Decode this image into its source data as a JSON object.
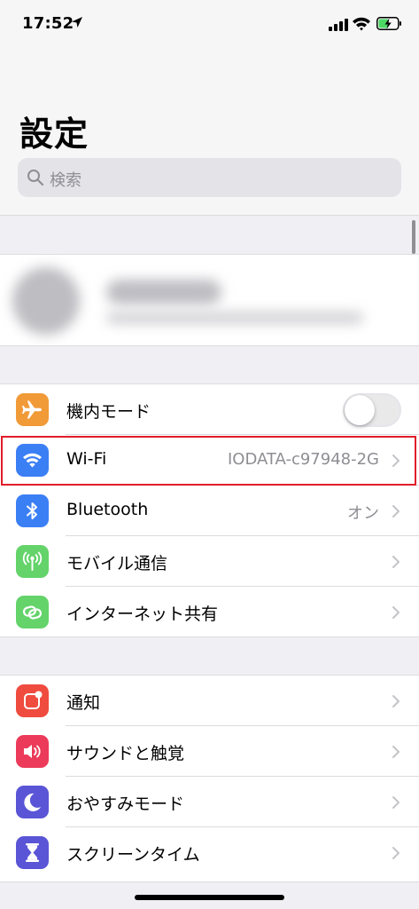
{
  "status_bar": {
    "time": "17:52",
    "icons": [
      "location-arrow-icon",
      "cellular-signal-icon",
      "wifi-icon",
      "battery-charging-icon"
    ]
  },
  "header": {
    "title": "設定",
    "search_placeholder": "検索"
  },
  "groups": [
    {
      "rows": [
        {
          "label": "機内モード",
          "icon": "airplane-icon",
          "icon_color": "#f19a38",
          "control": "toggle",
          "toggle_on": false
        },
        {
          "label": "Wi-Fi",
          "icon": "wifi-icon",
          "icon_color": "#3b7ff5",
          "value": "IODATA-c97948-2G",
          "highlighted": true
        },
        {
          "label": "Bluetooth",
          "icon": "bluetooth-icon",
          "icon_color": "#3b7ff5",
          "value": "オン"
        },
        {
          "label": "モバイル通信",
          "icon": "antenna-icon",
          "icon_color": "#64d36a",
          "value": ""
        },
        {
          "label": "インターネット共有",
          "icon": "link-chain-icon",
          "icon_color": "#64d36a",
          "value": ""
        }
      ]
    },
    {
      "rows": [
        {
          "label": "通知",
          "icon": "notification-icon",
          "icon_color": "#ef4b3e",
          "value": ""
        },
        {
          "label": "サウンドと触覚",
          "icon": "speaker-icon",
          "icon_color": "#ec3b5a",
          "value": ""
        },
        {
          "label": "おやすみモード",
          "icon": "moon-icon",
          "icon_color": "#5a55d6",
          "value": ""
        },
        {
          "label": "スクリーンタイム",
          "icon": "hourglass-icon",
          "icon_color": "#5a55d6",
          "value": ""
        }
      ]
    }
  ],
  "colors": {
    "highlight_border": "#e11d2a",
    "background": "#efeff4"
  }
}
